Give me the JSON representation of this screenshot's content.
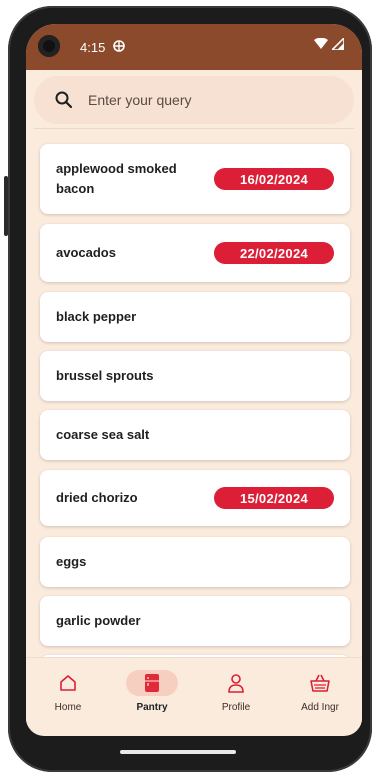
{
  "status": {
    "time": "4:15"
  },
  "search": {
    "placeholder": "Enter your query"
  },
  "items": [
    {
      "label": "applewood smoked bacon",
      "date": "16/02/2024"
    },
    {
      "label": "avocados",
      "date": "22/02/2024"
    },
    {
      "label": "black pepper"
    },
    {
      "label": "brussel sprouts"
    },
    {
      "label": "coarse sea salt"
    },
    {
      "label": "dried chorizo",
      "date": "15/02/2024"
    },
    {
      "label": "eggs"
    },
    {
      "label": "garlic powder"
    }
  ],
  "nav": [
    {
      "label": "Home",
      "icon": "home-icon"
    },
    {
      "label": "Pantry",
      "icon": "fridge-icon",
      "active": true
    },
    {
      "label": "Profile",
      "icon": "person-icon"
    },
    {
      "label": "Add Ingr",
      "icon": "basket-icon"
    }
  ],
  "colors": {
    "status_bar": "#8b4a2b",
    "background": "#fbebdd",
    "badge": "#dc1f36",
    "active_nav": "#f6cfc0",
    "fridge": "#e02a3a"
  }
}
